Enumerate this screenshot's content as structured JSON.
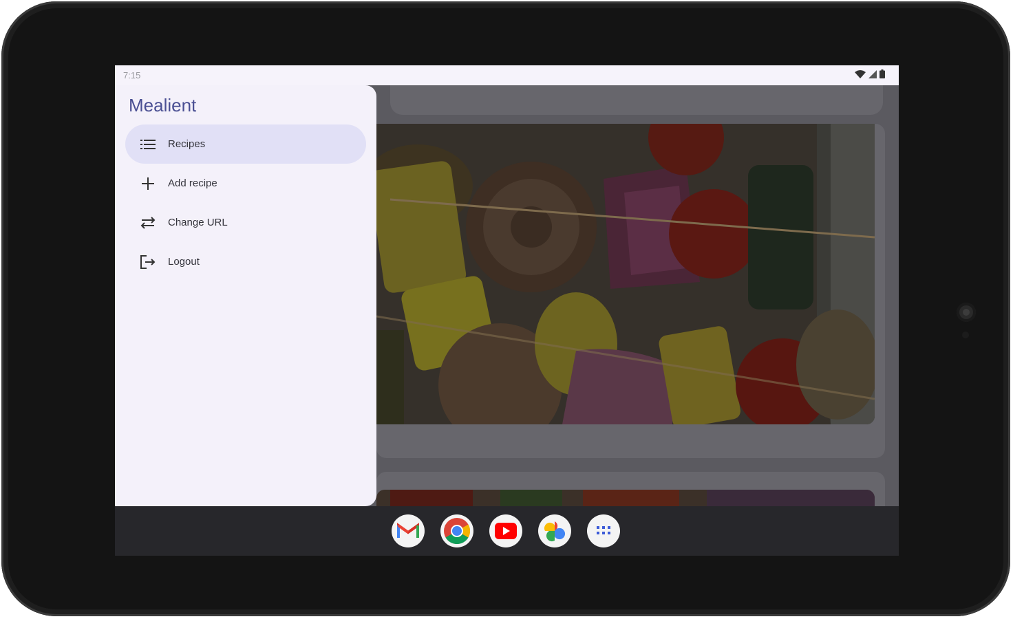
{
  "status": {
    "time": "7:15"
  },
  "app": {
    "title": "Mealient"
  },
  "drawer": {
    "items": [
      {
        "label": "Recipes",
        "icon": "list-icon",
        "active": true
      },
      {
        "label": "Add recipe",
        "icon": "plus-icon",
        "active": false
      },
      {
        "label": "Change URL",
        "icon": "swap-icon",
        "active": false
      },
      {
        "label": "Logout",
        "icon": "logout-icon",
        "active": false
      }
    ]
  },
  "dock": {
    "apps": [
      {
        "name": "Gmail",
        "icon": "gmail-icon"
      },
      {
        "name": "Chrome",
        "icon": "chrome-icon"
      },
      {
        "name": "YouTube",
        "icon": "youtube-icon"
      },
      {
        "name": "Photos",
        "icon": "photos-icon"
      },
      {
        "name": "All apps",
        "icon": "apps-grid-icon"
      }
    ]
  },
  "colors": {
    "accent": "#4a4f93",
    "active_item": "#e1e0f6",
    "drawer_bg": "#f4f1fa"
  }
}
